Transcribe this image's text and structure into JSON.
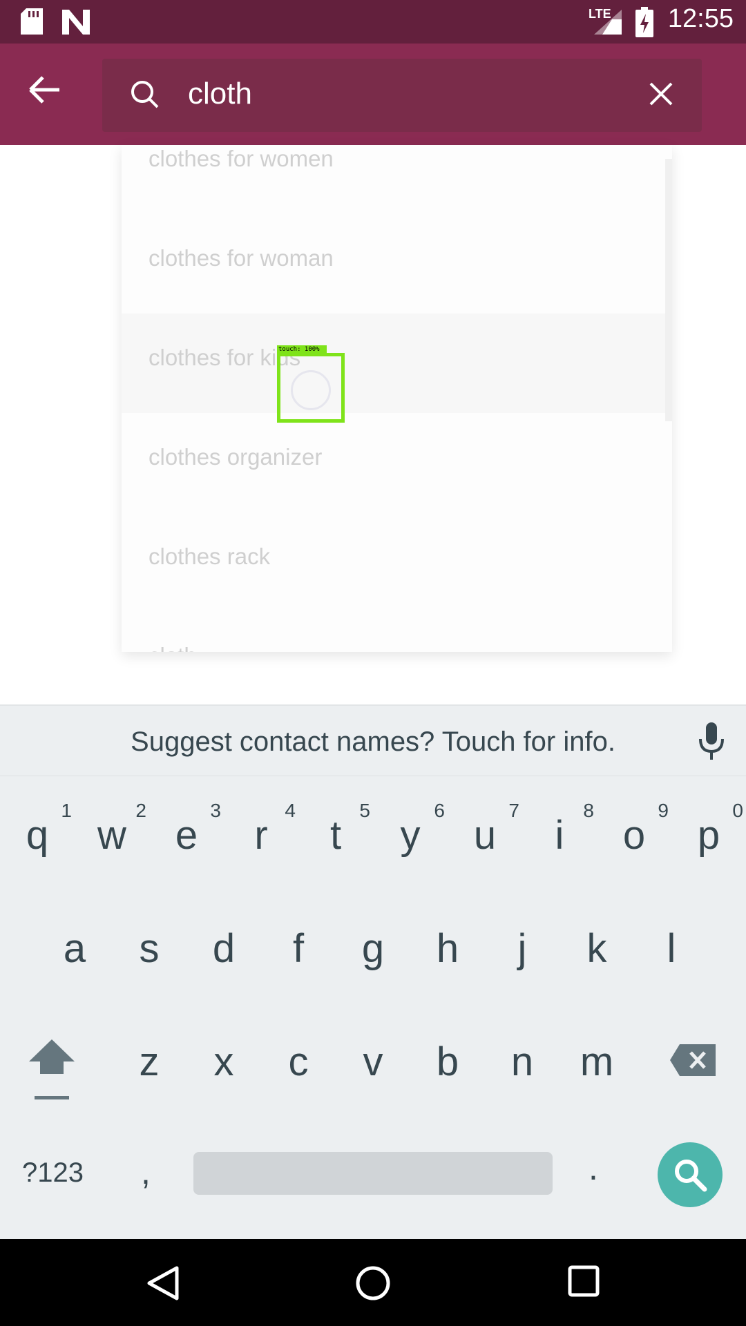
{
  "status_bar": {
    "time": "12:55",
    "network": "LTE",
    "icons": [
      "sd-card-icon",
      "n-logo-icon",
      "signal-icon",
      "battery-charging-icon"
    ]
  },
  "app_bar": {
    "back_icon": "arrow-back-icon",
    "search_icon": "search-icon",
    "query": "cloth",
    "clear_icon": "close-icon"
  },
  "suggestions": [
    "clothes for women",
    "clothes for woman",
    "clothes for kids",
    "clothes organizer",
    "clothes rack",
    "cloth"
  ],
  "touch_overlay": {
    "label": "touch: 100%"
  },
  "keyboard": {
    "suggestion_bar": "Suggest contact names? Touch for info.",
    "row1": [
      {
        "key": "q",
        "hint": "1"
      },
      {
        "key": "w",
        "hint": "2"
      },
      {
        "key": "e",
        "hint": "3"
      },
      {
        "key": "r",
        "hint": "4"
      },
      {
        "key": "t",
        "hint": "5"
      },
      {
        "key": "y",
        "hint": "6"
      },
      {
        "key": "u",
        "hint": "7"
      },
      {
        "key": "i",
        "hint": "8"
      },
      {
        "key": "o",
        "hint": "9"
      },
      {
        "key": "p",
        "hint": "0"
      }
    ],
    "row2": [
      "a",
      "s",
      "d",
      "f",
      "g",
      "h",
      "j",
      "k",
      "l"
    ],
    "row3": [
      "z",
      "x",
      "c",
      "v",
      "b",
      "n",
      "m"
    ],
    "symbols_label": "?123",
    "comma": ",",
    "period": ".",
    "action_icon": "search-icon"
  },
  "nav_bar": {
    "icons": [
      "back-triangle-icon",
      "home-circle-icon",
      "recents-square-icon"
    ]
  },
  "colors": {
    "status_bar": "#63203d",
    "app_bar": "#8a2b52",
    "search_key": "#4db6ac",
    "touch_box": "#7fe31a"
  }
}
